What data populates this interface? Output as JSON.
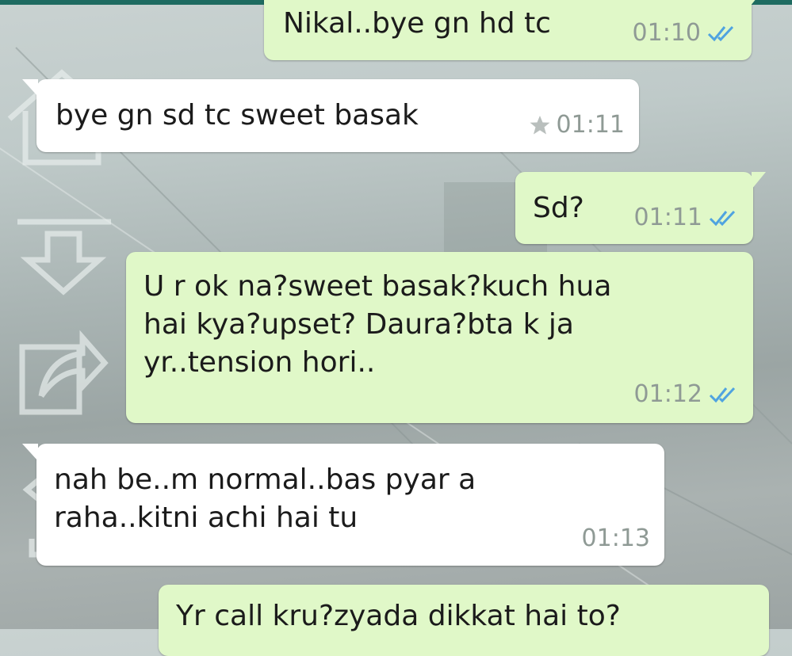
{
  "colors": {
    "sent_bubble": "#e0f8c8",
    "received_bubble": "#ffffff",
    "tick_blue": "#4fa3e0",
    "time_gray": "#8f9a95"
  },
  "messages": [
    {
      "direction": "sent",
      "text": "Nikal..bye gn hd tc",
      "time": "01:10",
      "status": "read-ticks-icon",
      "starred": false
    },
    {
      "direction": "received",
      "text": "bye gn sd tc sweet basak",
      "time": "01:11",
      "starred": true
    },
    {
      "direction": "sent",
      "text": "Sd?",
      "time": "01:11",
      "status": "read-ticks-icon",
      "starred": false
    },
    {
      "direction": "sent",
      "text": "U r ok na?sweet basak?kuch hua\nhai kya?upset? Daura?bta k ja\nyr..tension hori..",
      "time": "01:12",
      "status": "read-ticks-icon",
      "starred": false
    },
    {
      "direction": "received",
      "text": "nah be..m normal..bas pyar a\nraha..kitni achi hai tu",
      "time": "01:13",
      "starred": false
    },
    {
      "direction": "sent",
      "text": "Yr call kru?zyada dikkat hai to?",
      "partial": true
    }
  ],
  "overlay_icons": [
    "home-icon",
    "collapse-icon",
    "share-icon",
    "reply-icon"
  ]
}
